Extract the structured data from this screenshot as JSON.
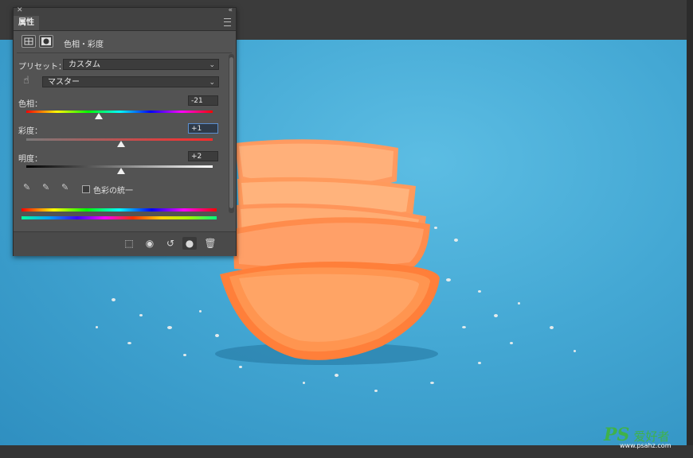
{
  "panel": {
    "tab_title": "属性",
    "adjustment_name": "色相・彩度",
    "preset_label": "プリセット：",
    "preset_value": "カスタム",
    "channel_value": "マスター",
    "hue": {
      "label": "色相：",
      "value": "-21",
      "position": 0.39
    },
    "saturation": {
      "label": "彩度：",
      "value": "+1",
      "position": 0.51
    },
    "lightness": {
      "label": "明度：",
      "value": "+2",
      "position": 0.51
    },
    "colorize_label": "色彩の統一",
    "colorize_checked": false
  },
  "icons": {
    "close": "close-icon",
    "collapse": "collapse-icon",
    "panel_menu": "panel-menu-icon",
    "hue_sat_layer": "hue-saturation-layer-icon",
    "mask": "mask-icon",
    "target_adjust": "targeted-adjustment-hand-icon",
    "eyedropper": "eyedropper-icon",
    "eyedropper_add": "eyedropper-plus-icon",
    "eyedropper_subtract": "eyedropper-minus-icon",
    "clip_to_layer": "clip-to-layer-icon",
    "view_previous": "view-previous-state-icon",
    "reset": "reset-icon",
    "visibility": "visibility-eye-icon",
    "delete": "trash-icon"
  },
  "watermark": {
    "ps": "PS",
    "cn": "爱好者",
    "url": "www.psahz.com"
  },
  "colors": {
    "background_blue": "#44a8d4",
    "orange": "#ff8a4a",
    "panel": "#535353"
  }
}
